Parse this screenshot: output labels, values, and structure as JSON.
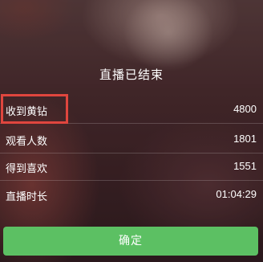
{
  "title": "直播已结束",
  "stats": [
    {
      "label": "收到黄钻",
      "value": "4800"
    },
    {
      "label": "观看人数",
      "value": "1801"
    },
    {
      "label": "得到喜欢",
      "value": "1551"
    },
    {
      "label": "直播时长",
      "value": "01:04:29"
    }
  ],
  "confirm_label": "确定",
  "colors": {
    "confirm_button": "#5cc063",
    "highlight_border": "#e0463e"
  }
}
